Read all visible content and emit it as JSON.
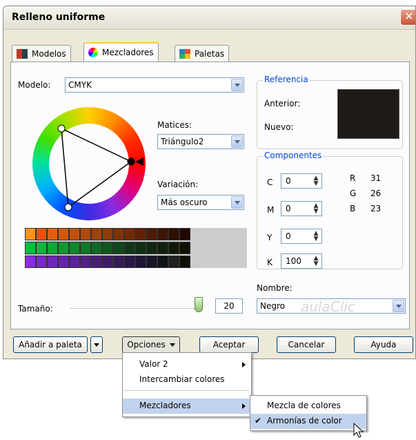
{
  "window": {
    "title": "Relleno uniforme",
    "close_glyph": "✕"
  },
  "tabs": [
    {
      "label": "Modelos",
      "icon": "models-icon"
    },
    {
      "label": "Mezcladores",
      "icon": "mixers-icon"
    },
    {
      "label": "Paletas",
      "icon": "palettes-icon"
    }
  ],
  "model": {
    "label": "Modelo:",
    "value": "CMYK"
  },
  "hues": {
    "label": "Matices:",
    "value": "Triángulo2"
  },
  "variation": {
    "label": "Variación:",
    "value": "Más oscuro"
  },
  "reference": {
    "title": "Referencia",
    "old_label": "Anterior:",
    "new_label": "Nuevo:",
    "swatch_color": "#1f1a17"
  },
  "components": {
    "title": "Componentes",
    "cmyk": [
      {
        "label": "C",
        "value": "0"
      },
      {
        "label": "M",
        "value": "0"
      },
      {
        "label": "Y",
        "value": "0"
      },
      {
        "label": "K",
        "value": "100"
      }
    ],
    "rgb": [
      {
        "label": "R",
        "value": "31"
      },
      {
        "label": "G",
        "value": "26"
      },
      {
        "label": "B",
        "value": "23"
      }
    ]
  },
  "name": {
    "label": "Nombre:",
    "value": "Negro"
  },
  "size": {
    "label": "Tamaño:",
    "value": "20"
  },
  "buttons": {
    "add_palette": "Añadir a paleta",
    "options": "Opciones",
    "accept": "Aceptar",
    "cancel": "Cancelar",
    "help": "Ayuda"
  },
  "options_menu": [
    {
      "label": "Valor 2",
      "submenu": true
    },
    {
      "label": "Intercambiar colores",
      "submenu": false
    },
    {
      "label": "Mezcladores",
      "submenu": true
    }
  ],
  "mixers_submenu": [
    {
      "label": "Mezcla de colores",
      "checked": false
    },
    {
      "label": "Armonías de color",
      "checked": true
    }
  ],
  "check_glyph": "✔",
  "watermark": "aulaClic",
  "colors": {
    "accent": "#0046d5",
    "swatch_rows": [
      [
        "#f7941d",
        "#e8540c",
        "#e06010",
        "#d05a10",
        "#c0520e",
        "#b04a0c",
        "#a0420a",
        "#903a08",
        "#803206",
        "#702a05",
        "#602204",
        "#501a03",
        "#401402",
        "#300e01",
        "#200800"
      ],
      [
        "#00c040",
        "#10b83a",
        "#10a834",
        "#109830",
        "#10882c",
        "#107828",
        "#106824",
        "#105820",
        "#10481c",
        "#103818",
        "#103014",
        "#102810",
        "#10200c",
        "#101808",
        "#101004"
      ],
      [
        "#8a2be2",
        "#7a28c8",
        "#7026b8",
        "#6624a8",
        "#5c2298",
        "#522088",
        "#481e78",
        "#3e1c68",
        "#341a58",
        "#2a1848",
        "#201638",
        "#181428",
        "#101218",
        "#202020",
        "#101008"
      ]
    ]
  }
}
